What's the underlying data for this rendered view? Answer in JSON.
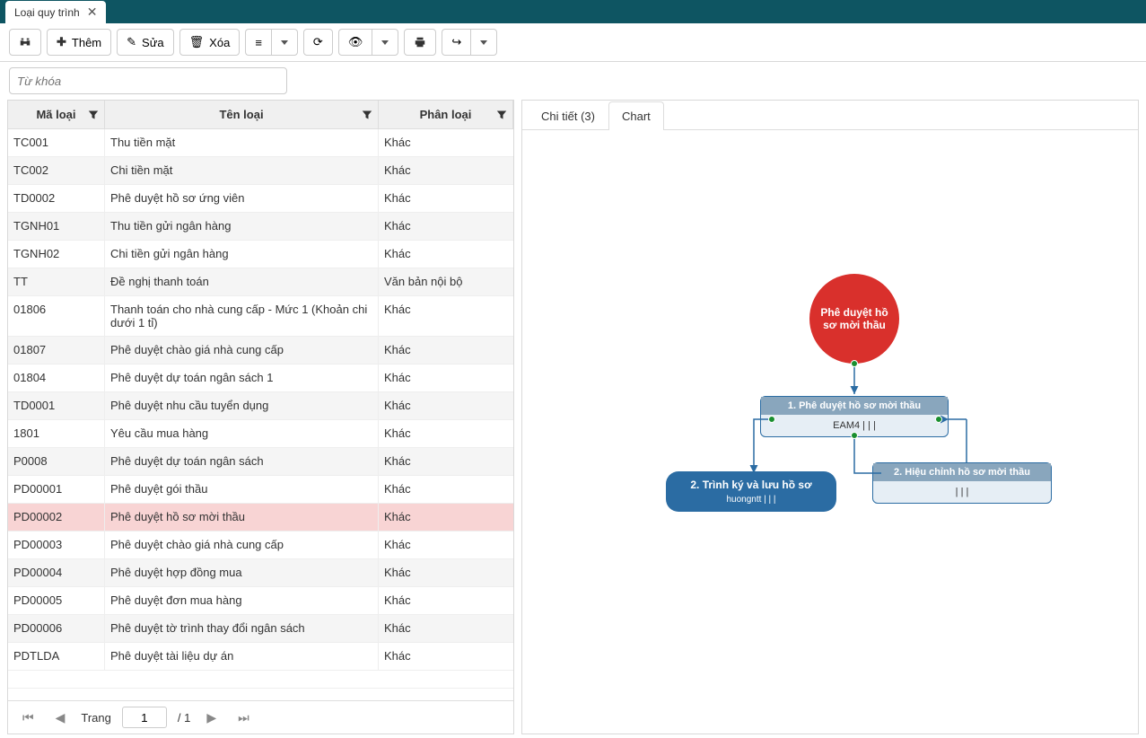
{
  "tab": {
    "title": "Loại quy trình"
  },
  "toolbar": {
    "add": "Thêm",
    "edit": "Sửa",
    "delete": "Xóa"
  },
  "search": {
    "placeholder": "Từ khóa"
  },
  "grid": {
    "headers": {
      "code": "Mã loại",
      "name": "Tên loại",
      "category": "Phân loại"
    },
    "rows": [
      {
        "code": "TC001",
        "name": "Thu tiền mặt",
        "cat": "Khác"
      },
      {
        "code": "TC002",
        "name": "Chi tiền mặt",
        "cat": "Khác"
      },
      {
        "code": "TD0002",
        "name": "Phê duyệt hồ sơ ứng viên",
        "cat": "Khác"
      },
      {
        "code": "TGNH01",
        "name": "Thu tiền gửi ngân hàng",
        "cat": "Khác"
      },
      {
        "code": "TGNH02",
        "name": "Chi tiền gửi ngân hàng",
        "cat": "Khác"
      },
      {
        "code": "TT",
        "name": "Đề nghị thanh toán",
        "cat": "Văn bản nội bộ"
      },
      {
        "code": "01806",
        "name": "Thanh toán cho nhà cung cấp - Mức 1 (Khoản chi dưới 1 tỉ)",
        "cat": "Khác"
      },
      {
        "code": "01807",
        "name": "Phê duyệt chào giá nhà cung cấp",
        "cat": "Khác"
      },
      {
        "code": "01804",
        "name": "Phê duyệt dự toán ngân sách 1",
        "cat": "Khác"
      },
      {
        "code": "TD0001",
        "name": "Phê duyệt nhu cầu tuyển dụng",
        "cat": "Khác"
      },
      {
        "code": "1801",
        "name": "Yêu cầu mua hàng",
        "cat": "Khác"
      },
      {
        "code": "P0008",
        "name": "Phê duyệt dự toán ngân sách",
        "cat": "Khác"
      },
      {
        "code": "PD00001",
        "name": "Phê duyệt gói thầu",
        "cat": "Khác"
      },
      {
        "code": "PD00002",
        "name": "Phê duyệt hồ sơ mời thầu",
        "cat": "Khác",
        "selected": true
      },
      {
        "code": "PD00003",
        "name": "Phê duyệt chào giá nhà cung cấp",
        "cat": "Khác"
      },
      {
        "code": "PD00004",
        "name": "Phê duyệt hợp đồng mua",
        "cat": "Khác"
      },
      {
        "code": "PD00005",
        "name": "Phê duyệt đơn mua hàng",
        "cat": "Khác"
      },
      {
        "code": "PD00006",
        "name": "Phê duyệt tờ trình thay đổi ngân sách",
        "cat": "Khác"
      },
      {
        "code": "PDTLDA",
        "name": "Phê duyệt tài liệu dự án",
        "cat": "Khác"
      }
    ],
    "pager": {
      "label": "Trang",
      "current": "1",
      "total": "/ 1"
    }
  },
  "rightTabs": {
    "detail": "Chi tiết (3)",
    "chart": "Chart"
  },
  "flow": {
    "start": "Phê duyệt hồ sơ mời thầu",
    "step1": {
      "title": "1. Phê duyệt hồ sơ mời thầu",
      "body": "EAM4 | | |"
    },
    "step2": {
      "title": "2. Trình ký và lưu hồ sơ",
      "body": "huongntt | | |"
    },
    "step3": {
      "title": "2. Hiệu chỉnh hồ sơ mời thầu",
      "body": "| | |"
    }
  }
}
